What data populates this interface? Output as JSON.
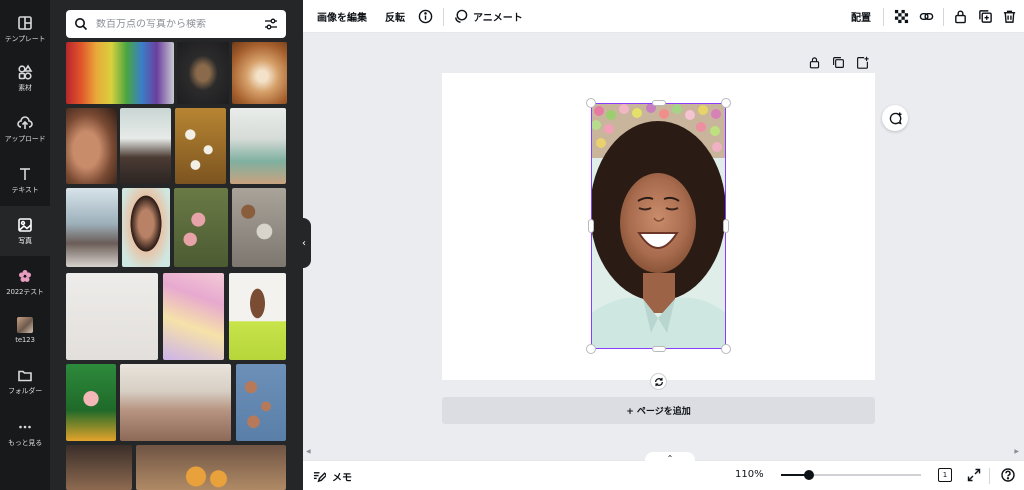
{
  "rail": {
    "items": [
      {
        "label": "テンプレート",
        "icon": "template-icon"
      },
      {
        "label": "素材",
        "icon": "elements-icon"
      },
      {
        "label": "アップロード",
        "icon": "upload-icon"
      },
      {
        "label": "テキスト",
        "icon": "text-icon"
      },
      {
        "label": "写真",
        "icon": "photo-icon"
      },
      {
        "label": "2022テスト",
        "icon": "flower-icon"
      },
      {
        "label": "te123",
        "icon": "folder-thumbnail"
      },
      {
        "label": "フォルダー",
        "icon": "folder-icon"
      },
      {
        "label": "もっと見る",
        "icon": "more-icon"
      }
    ],
    "active": "写真"
  },
  "search": {
    "placeholder": "数百万点の写真から検索"
  },
  "toolbar": {
    "edit_image": "画像を編集",
    "flip": "反転",
    "animate": "アニメート",
    "position": "配置"
  },
  "zoom": {
    "level_text": "110%",
    "level": 0.2
  },
  "bottombar": {
    "memo": "メモ",
    "page_count": "1"
  },
  "canvas": {
    "add_page": "+ ページを追加"
  },
  "colors": {
    "accent": "#8b3dff",
    "rail_bg": "#18191b",
    "panel_bg": "#252627"
  }
}
